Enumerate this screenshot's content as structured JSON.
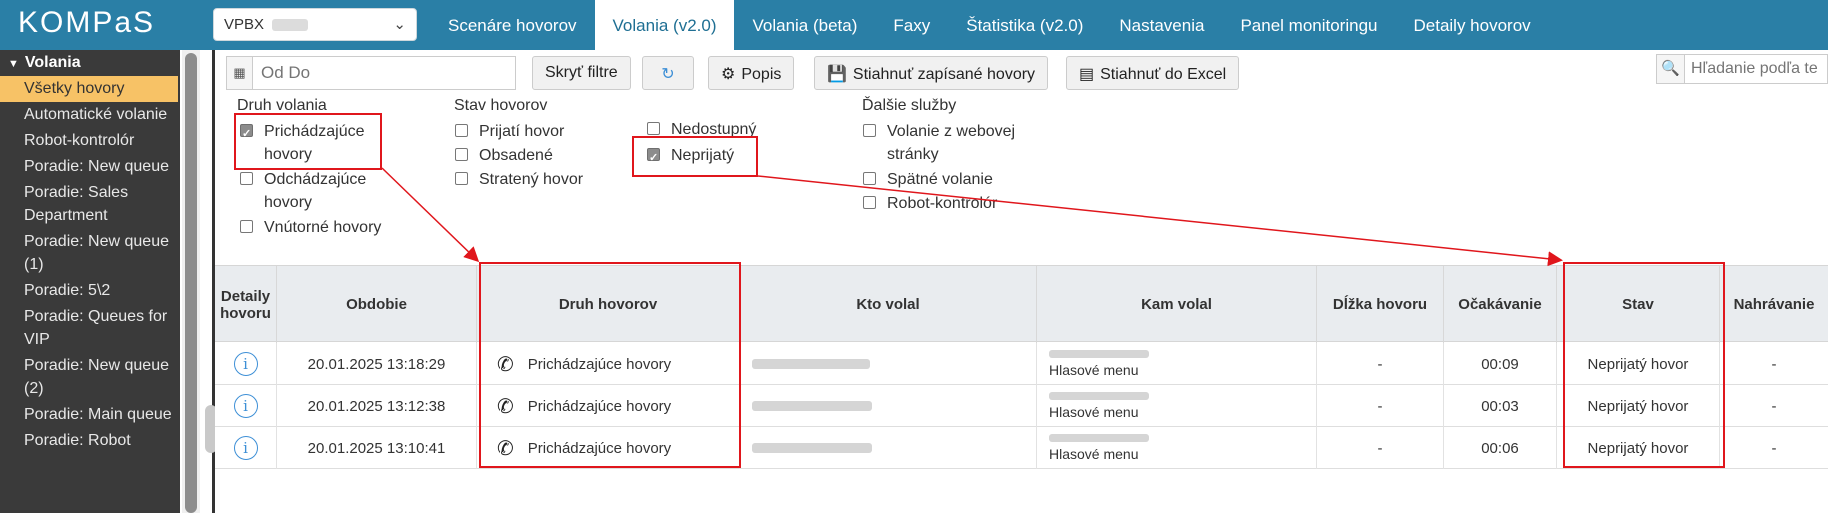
{
  "app": {
    "logo": "KOMPaS"
  },
  "pbx_select": {
    "value": "VPBX"
  },
  "nav": {
    "tabs": [
      {
        "label": "Scenáre hovorov"
      },
      {
        "label": "Volania (v2.0)"
      },
      {
        "label": "Volania (beta)"
      },
      {
        "label": "Faxy"
      },
      {
        "label": "Štatistika (v2.0)"
      },
      {
        "label": "Nastavenia"
      },
      {
        "label": "Panel monitoringu"
      },
      {
        "label": "Detaily hovorov"
      }
    ],
    "active_tab": "Volania (v2.0)"
  },
  "sidebar": {
    "section": "Volania",
    "items": [
      {
        "label": "Všetky hovory"
      },
      {
        "label": "Automatické volanie"
      },
      {
        "label": "Robot-kontrolór"
      },
      {
        "label": "Poradie: New queue"
      },
      {
        "label": "Poradie: Sales Department"
      },
      {
        "label": "Poradie: New queue (1)"
      },
      {
        "label": "Poradie: 5\\2"
      },
      {
        "label": "Poradie: Queues for VIP"
      },
      {
        "label": "Poradie: New queue (2)"
      },
      {
        "label": "Poradie: Main queue"
      },
      {
        "label": "Poradie: Robot"
      }
    ]
  },
  "toolbar": {
    "date_placeholder": "Od Do",
    "hide_filters": "Skryť filtre",
    "description": "Popis",
    "download_recorded": "Stiahnuť zapísané hovory",
    "download_excel": "Stiahnuť do Excel",
    "search_placeholder": "Hľadanie podľa te"
  },
  "filters": {
    "call_type": {
      "title": "Druh volania",
      "options": [
        {
          "label": "Prichádzajúce hovory",
          "checked": true
        },
        {
          "label": "Odchádzajúce hovory",
          "checked": false
        },
        {
          "label": "Vnútorné hovory",
          "checked": false
        }
      ]
    },
    "call_status": {
      "title": "Stav hovorov",
      "options": [
        {
          "label": "Prijatí hovor",
          "checked": false
        },
        {
          "label": "Obsadené",
          "checked": false
        },
        {
          "label": "Stratený hovor",
          "checked": false
        },
        {
          "label": "Nedostupný",
          "checked": false
        },
        {
          "label": "Neprijatý",
          "checked": true
        }
      ]
    },
    "extra_services": {
      "title": "Ďalšie služby",
      "options": [
        {
          "label": "Volanie z webovej stránky",
          "checked": false
        },
        {
          "label": "Spätné volanie",
          "checked": false
        },
        {
          "label": "Robot-kontrolór",
          "checked": false
        }
      ]
    }
  },
  "table": {
    "columns": [
      "Detaily hovoru",
      "Obdobie",
      "Druh hovorov",
      "Kto volal",
      "Kam volal",
      "Dĺžka hovoru",
      "Očakávanie",
      "Stav",
      "Nahrávanie"
    ],
    "rows": [
      {
        "period": "20.01.2025 13:18:29",
        "type": "Prichádzajúce hovory",
        "where_sub": "Hlasové menu",
        "duration": "-",
        "wait": "00:09",
        "status": "Neprijatý hovor",
        "recording": "-"
      },
      {
        "period": "20.01.2025 13:12:38",
        "type": "Prichádzajúce hovory",
        "where_sub": "Hlasové menu",
        "duration": "-",
        "wait": "00:03",
        "status": "Neprijatý hovor",
        "recording": "-"
      },
      {
        "period": "20.01.2025 13:10:41",
        "type": "Prichádzajúce hovory",
        "where_sub": "Hlasové menu",
        "duration": "-",
        "wait": "00:06",
        "status": "Neprijatý hovor",
        "recording": "-"
      }
    ]
  },
  "colors": {
    "header": "#2a7fa6",
    "sidebar": "#3a3a3a",
    "sidebar_active": "#f7c266",
    "annotation": "#e0161c"
  }
}
